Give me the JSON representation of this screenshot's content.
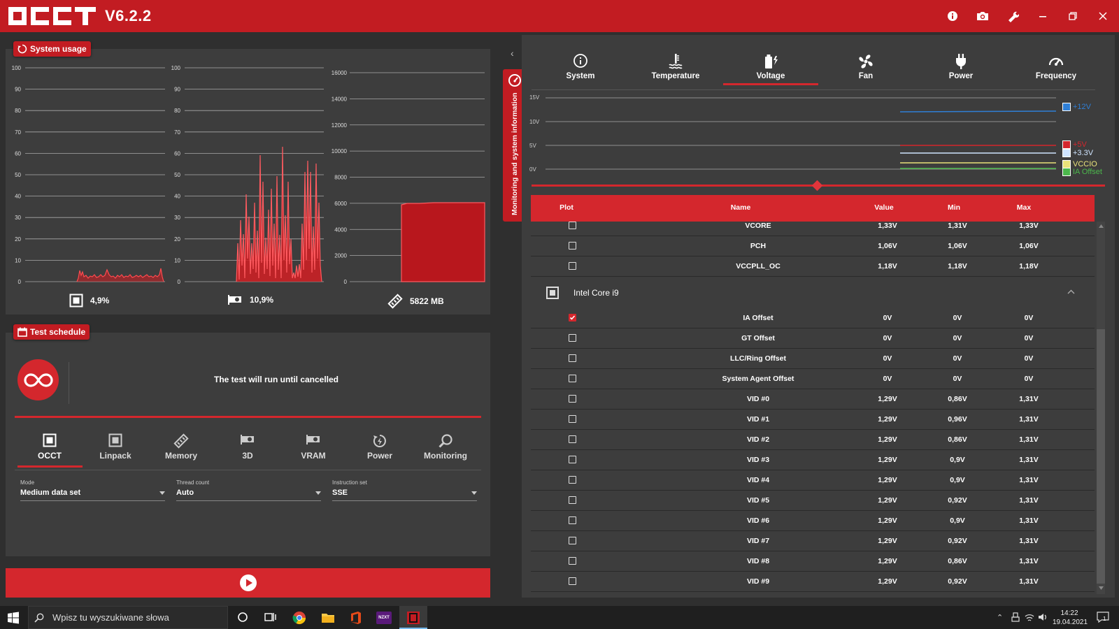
{
  "app": {
    "logo_text": "OCCT",
    "version": "V6.2.2",
    "title_icons": [
      "info-icon",
      "camera-icon",
      "wrench-icon",
      "minimize-icon",
      "restore-icon",
      "close-icon"
    ]
  },
  "system_usage": {
    "badge": "System usage",
    "cpu_chart": {
      "ticks": [
        "100",
        "90",
        "80",
        "70",
        "60",
        "50",
        "40",
        "30",
        "20",
        "10",
        "0"
      ],
      "value": "4,9%"
    },
    "gpu_chart": {
      "ticks": [
        "100",
        "90",
        "80",
        "70",
        "60",
        "50",
        "40",
        "30",
        "20",
        "10",
        "0"
      ],
      "value": "10,9%"
    },
    "mem_chart": {
      "ticks": [
        "16000",
        "14000",
        "12000",
        "10000",
        "8000",
        "6000",
        "4000",
        "2000",
        "0"
      ],
      "value": "5822 MB"
    }
  },
  "test_schedule": {
    "badge": "Test schedule",
    "message": "The test will run until cancelled",
    "tabs": [
      "OCCT",
      "Linpack",
      "Memory",
      "3D",
      "VRAM",
      "Power",
      "Monitoring"
    ],
    "active_tab": "OCCT",
    "fields": [
      {
        "label": "Mode",
        "value": "Medium data set"
      },
      {
        "label": "Thread count",
        "value": "Auto"
      },
      {
        "label": "Instruction set",
        "value": "SSE"
      }
    ]
  },
  "side_tab": {
    "label": "Monitoring and system information"
  },
  "monitor": {
    "tabs": [
      "System",
      "Temperature",
      "Voltage",
      "Fan",
      "Power",
      "Frequency"
    ],
    "active_tab": "Voltage",
    "graph": {
      "y_ticks": [
        "15V",
        "10V",
        "5V",
        "0V"
      ],
      "legend": [
        {
          "label": "+12V",
          "color": "#2f7fd6"
        },
        {
          "label": "+5V",
          "color": "#d4272d"
        },
        {
          "label": "+3.3V",
          "color": "#cfe4ff"
        },
        {
          "label": "VCCIO",
          "color": "#e9e27a"
        },
        {
          "label": "IA Offset",
          "color": "#4cb84c"
        }
      ]
    },
    "table": {
      "headers": {
        "plot": "Plot",
        "name": "Name",
        "value": "Value",
        "min": "Min",
        "max": "Max"
      },
      "top_rows": [
        {
          "name": "VCORE",
          "value": "1,33V",
          "min": "1,31V",
          "max": "1,33V",
          "checked": false
        },
        {
          "name": "PCH",
          "value": "1,06V",
          "min": "1,06V",
          "max": "1,06V",
          "checked": false
        },
        {
          "name": "VCCPLL_OC",
          "value": "1,18V",
          "min": "1,18V",
          "max": "1,18V",
          "checked": false
        }
      ],
      "group": "Intel Core i9",
      "group_rows": [
        {
          "name": "IA Offset",
          "value": "0V",
          "min": "0V",
          "max": "0V",
          "checked": true
        },
        {
          "name": "GT Offset",
          "value": "0V",
          "min": "0V",
          "max": "0V",
          "checked": false
        },
        {
          "name": "LLC/Ring Offset",
          "value": "0V",
          "min": "0V",
          "max": "0V",
          "checked": false
        },
        {
          "name": "System Agent Offset",
          "value": "0V",
          "min": "0V",
          "max": "0V",
          "checked": false
        },
        {
          "name": "VID #0",
          "value": "1,29V",
          "min": "0,86V",
          "max": "1,31V",
          "checked": false
        },
        {
          "name": "VID #1",
          "value": "1,29V",
          "min": "0,96V",
          "max": "1,31V",
          "checked": false
        },
        {
          "name": "VID #2",
          "value": "1,29V",
          "min": "0,86V",
          "max": "1,31V",
          "checked": false
        },
        {
          "name": "VID #3",
          "value": "1,29V",
          "min": "0,9V",
          "max": "1,31V",
          "checked": false
        },
        {
          "name": "VID #4",
          "value": "1,29V",
          "min": "0,9V",
          "max": "1,31V",
          "checked": false
        },
        {
          "name": "VID #5",
          "value": "1,29V",
          "min": "0,92V",
          "max": "1,31V",
          "checked": false
        },
        {
          "name": "VID #6",
          "value": "1,29V",
          "min": "0,9V",
          "max": "1,31V",
          "checked": false
        },
        {
          "name": "VID #7",
          "value": "1,29V",
          "min": "0,92V",
          "max": "1,31V",
          "checked": false
        },
        {
          "name": "VID #8",
          "value": "1,29V",
          "min": "0,86V",
          "max": "1,31V",
          "checked": false
        },
        {
          "name": "VID #9",
          "value": "1,29V",
          "min": "0,92V",
          "max": "1,31V",
          "checked": false
        }
      ]
    }
  },
  "taskbar": {
    "search_placeholder": "Wpisz tu wyszukiwane słowa",
    "time": "14:22",
    "date": "19.04.2021",
    "notification_count": "1"
  },
  "colors": {
    "accent": "#c21c22",
    "panel": "#3d3d3d",
    "background": "#2f2f2f"
  }
}
